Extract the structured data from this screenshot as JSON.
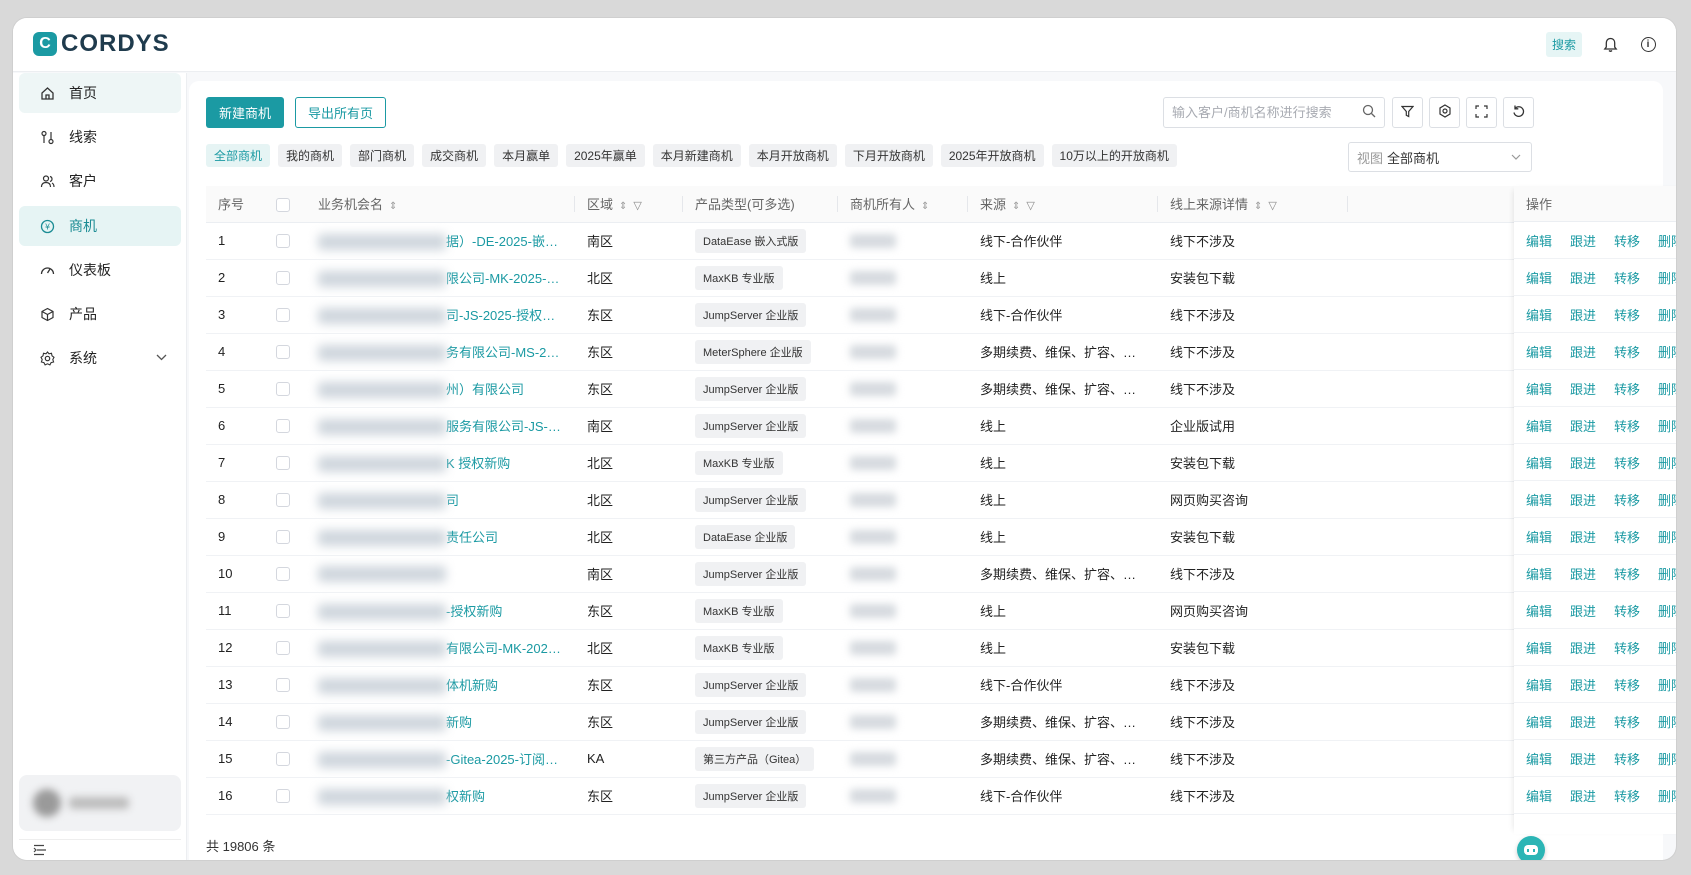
{
  "header": {
    "logo_text": "CORDYS",
    "search_label": "搜索"
  },
  "sidebar": {
    "items": [
      {
        "label": "首页",
        "icon": "home-icon"
      },
      {
        "label": "线索",
        "icon": "leads-icon"
      },
      {
        "label": "客户",
        "icon": "customer-icon"
      },
      {
        "label": "商机",
        "icon": "opportunity-icon"
      },
      {
        "label": "仪表板",
        "icon": "dashboard-icon"
      },
      {
        "label": "产品",
        "icon": "product-icon"
      },
      {
        "label": "系统",
        "icon": "settings-icon"
      }
    ]
  },
  "toolbar": {
    "new_button": "新建商机",
    "export_button": "导出所有页",
    "search_placeholder": "输入客户/商机名称进行搜索"
  },
  "chips": [
    "全部商机",
    "我的商机",
    "部门商机",
    "成交商机",
    "本月赢单",
    "2025年赢单",
    "本月新建商机",
    "本月开放商机",
    "下月开放商机",
    "2025年开放商机",
    "10万以上的开放商机"
  ],
  "view": {
    "prefix": "视图",
    "value": "全部商机"
  },
  "table": {
    "headers": {
      "index": "序号",
      "name": "业务机会名",
      "region": "区域",
      "product": "产品类型(可多选)",
      "owner": "商机所有人",
      "source": "来源",
      "online_source": "线上来源详情",
      "actions": "操作"
    },
    "actions": [
      "编辑",
      "跟进",
      "转移",
      "删除"
    ],
    "rows": [
      {
        "index": "1",
        "name": "据）-DE-2025-嵌…",
        "region": "南区",
        "product": "DataEase 嵌入式版",
        "source": "线下-合作伙伴",
        "online": "线下不涉及"
      },
      {
        "index": "2",
        "name": "限公司-MK-2025-…",
        "region": "北区",
        "product": "MaxKB 专业版",
        "source": "线上",
        "online": "安装包下载"
      },
      {
        "index": "3",
        "name": "司-JS-2025-授权…",
        "region": "东区",
        "product": "JumpServer 企业版",
        "source": "线下-合作伙伴",
        "online": "线下不涉及"
      },
      {
        "index": "4",
        "name": "务有限公司-MS-2…",
        "region": "东区",
        "product": "MeterSphere 企业版",
        "source": "多期续费、维保、扩容、…",
        "online": "线下不涉及"
      },
      {
        "index": "5",
        "name": "州）有限公司",
        "region": "东区",
        "product": "JumpServer 企业版",
        "source": "多期续费、维保、扩容、…",
        "online": "线下不涉及"
      },
      {
        "index": "6",
        "name": "服务有限公司-JS-…",
        "region": "南区",
        "product": "JumpServer 企业版",
        "source": "线上",
        "online": "企业版试用"
      },
      {
        "index": "7",
        "name": "K 授权新购",
        "region": "北区",
        "product": "MaxKB 专业版",
        "source": "线上",
        "online": "安装包下载"
      },
      {
        "index": "8",
        "name": "司",
        "region": "北区",
        "product": "JumpServer 企业版",
        "source": "线上",
        "online": "网页购买咨询"
      },
      {
        "index": "9",
        "name": "责任公司",
        "region": "北区",
        "product": "DataEase 企业版",
        "source": "线上",
        "online": "安装包下载"
      },
      {
        "index": "10",
        "name": "",
        "region": "南区",
        "product": "JumpServer 企业版",
        "source": "多期续费、维保、扩容、…",
        "online": "线下不涉及"
      },
      {
        "index": "11",
        "name": "-授权新购",
        "region": "东区",
        "product": "MaxKB 专业版",
        "source": "线上",
        "online": "网页购买咨询"
      },
      {
        "index": "12",
        "name": "有限公司-MK-202…",
        "region": "北区",
        "product": "MaxKB 专业版",
        "source": "线上",
        "online": "安装包下载"
      },
      {
        "index": "13",
        "name": "体机新购",
        "region": "东区",
        "product": "JumpServer 企业版",
        "source": "线下-合作伙伴",
        "online": "线下不涉及"
      },
      {
        "index": "14",
        "name": "新购",
        "region": "东区",
        "product": "JumpServer 企业版",
        "source": "多期续费、维保、扩容、…",
        "online": "线下不涉及"
      },
      {
        "index": "15",
        "name": "-Gitea-2025-订阅…",
        "region": "KA",
        "product": "第三方产品（Gitea）",
        "source": "多期续费、维保、扩容、…",
        "online": "线下不涉及"
      },
      {
        "index": "16",
        "name": "权新购",
        "region": "东区",
        "product": "JumpServer 企业版",
        "source": "线下-合作伙伴",
        "online": "线下不涉及"
      }
    ]
  },
  "footer": {
    "total": "共 19806 条"
  },
  "colors": {
    "accent": "#1b9aa3"
  }
}
